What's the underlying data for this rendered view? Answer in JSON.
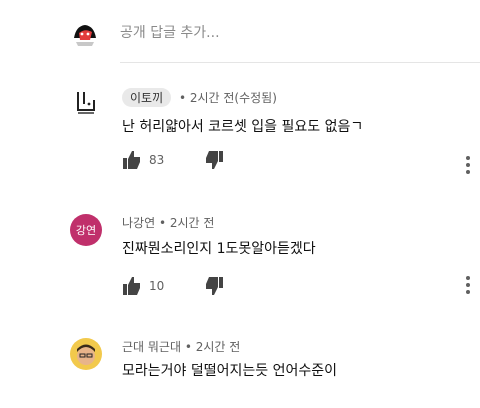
{
  "reply": {
    "placeholder": "공개 답글 추가..."
  },
  "comments": [
    {
      "author": "이토끼",
      "meta": "• 2시간 전(수정됨)",
      "text": "난 허리얇아서 코르셋 입을 필요도 없음ㄱ",
      "likes": "83"
    },
    {
      "author": "나강연",
      "avatar_text": "강연",
      "meta": "• 2시간 전",
      "text": "진짜뭔소리인지 1도못알아듣겠다",
      "likes": "10"
    },
    {
      "author": "근대 뭐근대",
      "meta": "• 2시간 전",
      "text": "모라는거야 덜떨어지는듯 언어수준이"
    }
  ],
  "colors": {
    "chip_bg": "#e9e9e9",
    "avatar2_bg": "#c0306b",
    "meta": "#606060"
  }
}
